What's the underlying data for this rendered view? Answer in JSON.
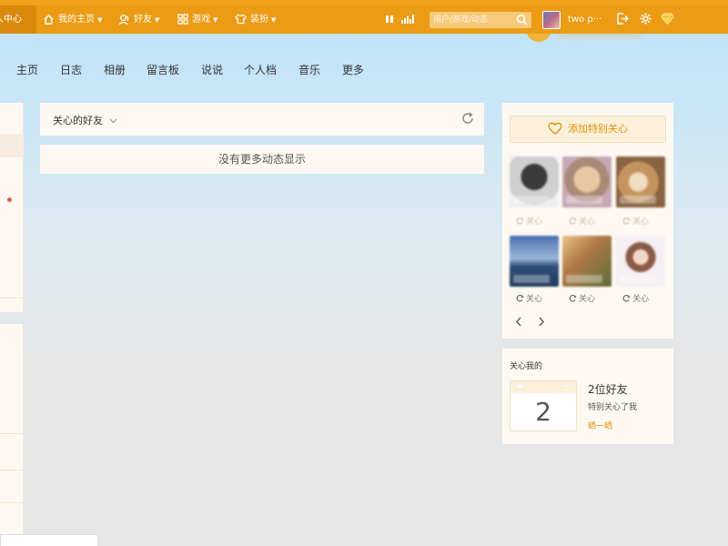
{
  "topbar": {
    "center_label": "个人中心",
    "home_label": "我的主页",
    "friends_label": "好友",
    "games_label": "游戏",
    "dress_label": "装扮",
    "search_placeholder": "用户/游戏/动态",
    "username": "two p···"
  },
  "nav": {
    "items": [
      "主页",
      "日志",
      "相册",
      "留言板",
      "说说",
      "个人档",
      "音乐",
      "更多"
    ]
  },
  "feed": {
    "filter_label": "关心的好友",
    "empty_text": "没有更多动态显示"
  },
  "special_care": {
    "button_label": "添加特别关心",
    "care_label": "关心",
    "prev_icon": "chevron-left-icon",
    "next_icon": "chevron-right-icon"
  },
  "care_me": {
    "title": "关心我的",
    "calendar_number": "2",
    "count_text": "2位好友",
    "desc": "特别关心了我",
    "link": "晒一晒"
  },
  "colors": {
    "topbar": "#eb9b14",
    "accent": "#e3920d",
    "panel": "#fdf9f2"
  }
}
